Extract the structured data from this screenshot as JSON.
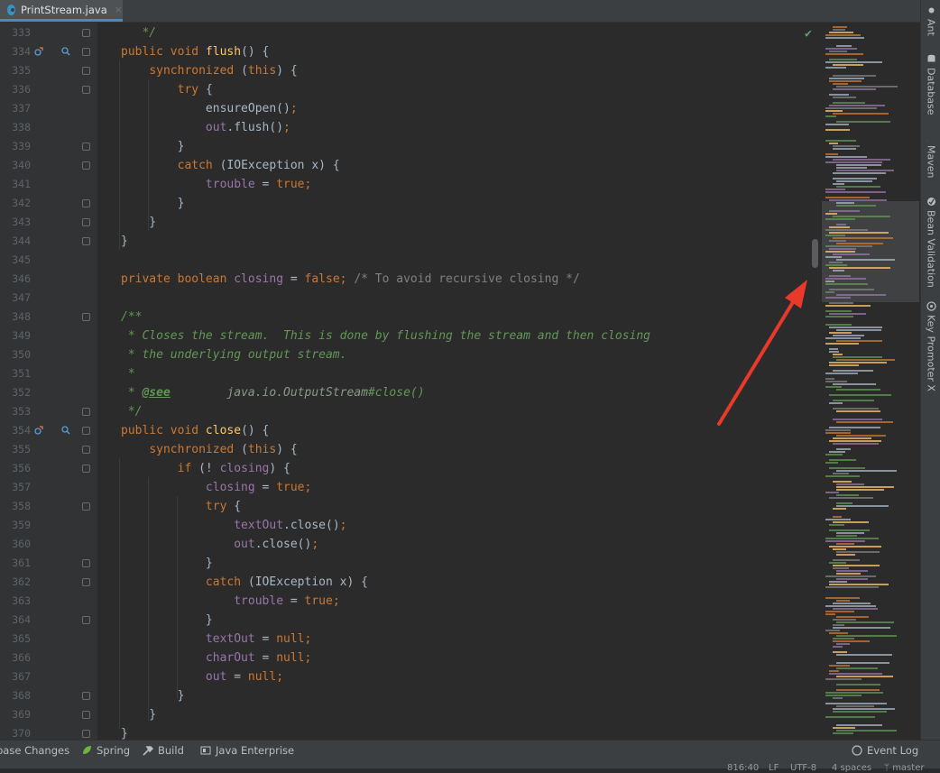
{
  "tab": {
    "filename": "PrintStream.java",
    "close": "×"
  },
  "colors": {
    "keyword": "#cc7832",
    "method": "#ffc66d",
    "field": "#9876aa",
    "comment": "#808080",
    "doc": "#629755",
    "annotation_arrow": "#e8392a"
  },
  "code_lines": [
    {
      "n": "333",
      "fold": true,
      "parts": [
        [
          "doc",
          "   */"
        ]
      ]
    },
    {
      "n": "334",
      "fold": true,
      "icons": true,
      "parts": [
        [
          "kw",
          "public void "
        ],
        [
          "fn",
          "flush"
        ],
        [
          "",
          "() {"
        ]
      ]
    },
    {
      "n": "335",
      "fold": true,
      "parts": [
        [
          "",
          "    "
        ],
        [
          "kw",
          "synchronized "
        ],
        [
          "",
          "("
        ],
        [
          "kw",
          "this"
        ],
        [
          "",
          ") {"
        ]
      ]
    },
    {
      "n": "336",
      "fold": true,
      "parts": [
        [
          "",
          "        "
        ],
        [
          "kw",
          "try "
        ],
        [
          "",
          "{"
        ]
      ]
    },
    {
      "n": "337",
      "parts": [
        [
          "",
          "            ensureOpen()"
        ],
        [
          "punc",
          ";"
        ]
      ]
    },
    {
      "n": "338",
      "parts": [
        [
          "",
          "            "
        ],
        [
          "fld",
          "out"
        ],
        [
          "",
          ".flush()"
        ],
        [
          "punc",
          ";"
        ]
      ]
    },
    {
      "n": "339",
      "fold": true,
      "parts": [
        [
          "",
          "        }"
        ]
      ]
    },
    {
      "n": "340",
      "fold": true,
      "parts": [
        [
          "",
          "        "
        ],
        [
          "kw",
          "catch "
        ],
        [
          "",
          "(IOException x) {"
        ]
      ]
    },
    {
      "n": "341",
      "parts": [
        [
          "",
          "            "
        ],
        [
          "fld",
          "trouble"
        ],
        [
          "",
          " = "
        ],
        [
          "kw",
          "true"
        ],
        [
          "punc",
          ";"
        ]
      ]
    },
    {
      "n": "342",
      "fold": true,
      "parts": [
        [
          "",
          "        }"
        ]
      ]
    },
    {
      "n": "343",
      "fold": true,
      "parts": [
        [
          "",
          "    }"
        ]
      ]
    },
    {
      "n": "344",
      "fold": true,
      "parts": [
        [
          "",
          "}"
        ]
      ]
    },
    {
      "n": "345",
      "parts": []
    },
    {
      "n": "346",
      "parts": [
        [
          "kw",
          "private boolean "
        ],
        [
          "fld",
          "closing"
        ],
        [
          "",
          " = "
        ],
        [
          "kw",
          "false"
        ],
        [
          "punc",
          "; "
        ],
        [
          "cm",
          "/* To avoid recursive closing */"
        ]
      ]
    },
    {
      "n": "347",
      "parts": []
    },
    {
      "n": "348",
      "fold": true,
      "parts": [
        [
          "doc",
          "/**"
        ]
      ]
    },
    {
      "n": "349",
      "parts": [
        [
          "doc",
          " * Closes the stream.  This is done by flushing the stream and then closing"
        ]
      ]
    },
    {
      "n": "350",
      "parts": [
        [
          "doc",
          " * the underlying output stream."
        ]
      ]
    },
    {
      "n": "351",
      "parts": [
        [
          "doc",
          " *"
        ]
      ]
    },
    {
      "n": "352",
      "parts": [
        [
          "doc",
          " * "
        ],
        [
          "tag",
          "@see"
        ],
        [
          "docref",
          "        java.io.OutputStream"
        ],
        [
          "doc",
          "#close()"
        ]
      ]
    },
    {
      "n": "353",
      "fold": true,
      "parts": [
        [
          "doc",
          " */"
        ]
      ]
    },
    {
      "n": "354",
      "fold": true,
      "icons": true,
      "parts": [
        [
          "kw",
          "public void "
        ],
        [
          "fn",
          "close"
        ],
        [
          "",
          "() {"
        ]
      ]
    },
    {
      "n": "355",
      "fold": true,
      "parts": [
        [
          "",
          "    "
        ],
        [
          "kw",
          "synchronized "
        ],
        [
          "",
          "("
        ],
        [
          "kw",
          "this"
        ],
        [
          "",
          ") {"
        ]
      ]
    },
    {
      "n": "356",
      "fold": true,
      "parts": [
        [
          "",
          "        "
        ],
        [
          "kw",
          "if "
        ],
        [
          "",
          "(! "
        ],
        [
          "fld",
          "closing"
        ],
        [
          "",
          ") {"
        ]
      ]
    },
    {
      "n": "357",
      "parts": [
        [
          "",
          "            "
        ],
        [
          "fld",
          "closing"
        ],
        [
          "",
          " = "
        ],
        [
          "kw",
          "true"
        ],
        [
          "punc",
          ";"
        ]
      ]
    },
    {
      "n": "358",
      "fold": true,
      "parts": [
        [
          "",
          "            "
        ],
        [
          "kw",
          "try "
        ],
        [
          "",
          "{"
        ]
      ]
    },
    {
      "n": "359",
      "parts": [
        [
          "",
          "                "
        ],
        [
          "fld",
          "textOut"
        ],
        [
          "",
          ".close()"
        ],
        [
          "punc",
          ";"
        ]
      ]
    },
    {
      "n": "360",
      "parts": [
        [
          "",
          "                "
        ],
        [
          "fld",
          "out"
        ],
        [
          "",
          ".close()"
        ],
        [
          "punc",
          ";"
        ]
      ]
    },
    {
      "n": "361",
      "fold": true,
      "parts": [
        [
          "",
          "            }"
        ]
      ]
    },
    {
      "n": "362",
      "fold": true,
      "parts": [
        [
          "",
          "            "
        ],
        [
          "kw",
          "catch "
        ],
        [
          "",
          "(IOException x) {"
        ]
      ]
    },
    {
      "n": "363",
      "parts": [
        [
          "",
          "                "
        ],
        [
          "fld",
          "trouble"
        ],
        [
          "",
          " = "
        ],
        [
          "kw",
          "true"
        ],
        [
          "punc",
          ";"
        ]
      ]
    },
    {
      "n": "364",
      "fold": true,
      "parts": [
        [
          "",
          "            }"
        ]
      ]
    },
    {
      "n": "365",
      "parts": [
        [
          "",
          "            "
        ],
        [
          "fld",
          "textOut"
        ],
        [
          "",
          " = "
        ],
        [
          "kw",
          "null"
        ],
        [
          "punc",
          ";"
        ]
      ]
    },
    {
      "n": "366",
      "parts": [
        [
          "",
          "            "
        ],
        [
          "fld",
          "charOut"
        ],
        [
          "",
          " = "
        ],
        [
          "kw",
          "null"
        ],
        [
          "punc",
          ";"
        ]
      ]
    },
    {
      "n": "367",
      "parts": [
        [
          "",
          "            "
        ],
        [
          "fld",
          "out"
        ],
        [
          "",
          " = "
        ],
        [
          "kw",
          "null"
        ],
        [
          "punc",
          ";"
        ]
      ]
    },
    {
      "n": "368",
      "fold": true,
      "parts": [
        [
          "",
          "        }"
        ]
      ]
    },
    {
      "n": "369",
      "fold": true,
      "parts": [
        [
          "",
          "    }"
        ]
      ]
    },
    {
      "n": "370",
      "fold": true,
      "parts": [
        [
          "",
          "}"
        ]
      ]
    }
  ],
  "right_tools": [
    {
      "label": "Ant",
      "icon": "ant-icon"
    },
    {
      "label": "Database",
      "icon": "database-icon"
    },
    {
      "label": "Maven",
      "icon": "maven-icon"
    },
    {
      "label": "Bean Validation",
      "icon": "bean-validation-icon"
    },
    {
      "label": "Key Promoter X",
      "icon": "key-promoter-icon"
    }
  ],
  "status": {
    "buttons": [
      {
        "label": "base Changes",
        "icon": ""
      },
      {
        "label": "Spring",
        "icon": "spring-icon"
      },
      {
        "label": "Build",
        "icon": "hammer-icon"
      },
      {
        "label": "Java Enterprise",
        "icon": "java-enterprise-icon"
      }
    ],
    "event_log": "Event Log",
    "position": "816:40",
    "line_sep": "LF",
    "encoding": "UTF-8",
    "indent": "4 spaces",
    "branch": "master"
  }
}
